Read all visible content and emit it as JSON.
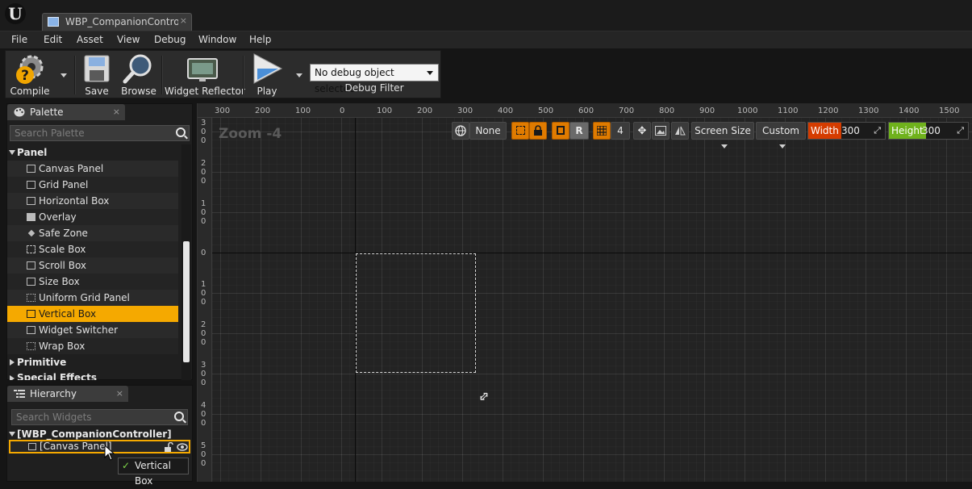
{
  "window": {
    "tab_title": "WBP_CompanionControll",
    "tab_close": "×"
  },
  "menu": [
    "File",
    "Edit",
    "Asset",
    "View",
    "Debug",
    "Window",
    "Help"
  ],
  "toolbar": {
    "compile": "Compile",
    "save": "Save",
    "browse": "Browse",
    "widget_reflector": "Widget Reflector",
    "play": "Play",
    "debug_object": "No debug object selected",
    "debug_filter": "Debug Filter"
  },
  "palette": {
    "tab": "Palette",
    "close": "×",
    "search_placeholder": "Search Palette",
    "category_panel": "Panel",
    "items": [
      "Canvas Panel",
      "Grid Panel",
      "Horizontal Box",
      "Overlay",
      "Safe Zone",
      "Scale Box",
      "Scroll Box",
      "Size Box",
      "Uniform Grid Panel",
      "Vertical Box",
      "Widget Switcher",
      "Wrap Box"
    ],
    "selected_item": "Vertical Box",
    "category_primitive": "Primitive",
    "category_special": "Special Effects"
  },
  "hierarchy": {
    "tab": "Hierarchy",
    "close": "×",
    "search_placeholder": "Search Widgets",
    "root": "[WBP_CompanionController]",
    "child": "[Canvas Panel]",
    "drag_tooltip": "Vertical Box"
  },
  "viewport": {
    "zoom": "Zoom -4",
    "ruler_x": [
      "300",
      "200",
      "100",
      "0",
      "100",
      "200",
      "300",
      "400",
      "500",
      "600",
      "700",
      "800",
      "900",
      "1000",
      "1100",
      "1200",
      "1300",
      "1400",
      "1500"
    ],
    "ruler_y": [
      "300",
      "200",
      "100",
      "0",
      "100",
      "200",
      "300",
      "400",
      "500"
    ],
    "toolbar": {
      "localization": "None",
      "respect_locks": "R",
      "grid_snap": "4",
      "screen_size": "Screen Size",
      "fill_mode": "Custom",
      "width_label": "Width",
      "width_value": "300",
      "height_label": "Height",
      "height_value": "300"
    }
  },
  "colors": {
    "accent": "#f5a900",
    "width_label": "#d53c00",
    "height_label": "#6fb21c"
  }
}
